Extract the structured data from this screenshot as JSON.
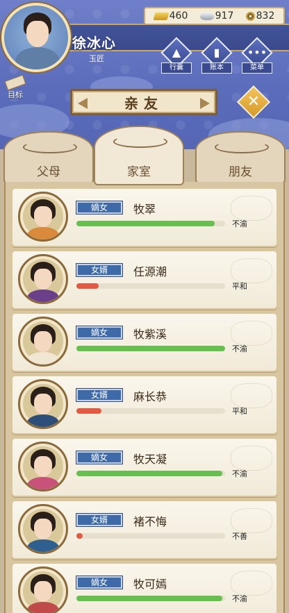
{
  "player": {
    "name": "徐冰心",
    "title": "玉匠"
  },
  "currency": {
    "gold": "460",
    "silver": "917",
    "copper": "832"
  },
  "menu": {
    "bag_label": "行囊",
    "ledger_label": "账本",
    "menu_label": "菜单",
    "goal_label": "目标"
  },
  "panel": {
    "title": "亲友",
    "close_glyph": "✕"
  },
  "tabs": [
    {
      "label": "父母",
      "active": false
    },
    {
      "label": "家室",
      "active": true
    },
    {
      "label": "朋友",
      "active": false
    }
  ],
  "colors": {
    "bar_green": "#66bf4f",
    "bar_red": "#e15a44",
    "role_blue": "#3e6aa8"
  },
  "relatives": [
    {
      "role": "嫡女",
      "name": "牧翠",
      "mood": "不渝",
      "bar_percent": 93,
      "bar_color": "green",
      "robe": "#d98a3b"
    },
    {
      "role": "女婿",
      "name": "任源潮",
      "mood": "平和",
      "bar_percent": 15,
      "bar_color": "red",
      "robe": "#6b3f8a"
    },
    {
      "role": "嫡女",
      "name": "牧紫溪",
      "mood": "不渝",
      "bar_percent": 100,
      "bar_color": "green",
      "robe": "#f0e6d2"
    },
    {
      "role": "女婿",
      "name": "麻长恭",
      "mood": "平和",
      "bar_percent": 17,
      "bar_color": "red",
      "robe": "#2e4e7a"
    },
    {
      "role": "嫡女",
      "name": "牧天凝",
      "mood": "不渝",
      "bar_percent": 98,
      "bar_color": "green",
      "robe": "#c9527a"
    },
    {
      "role": "女婿",
      "name": "褚不悔",
      "mood": "不善",
      "bar_percent": 4,
      "bar_color": "red",
      "robe": "#2f5f8f"
    },
    {
      "role": "嫡女",
      "name": "牧可嫣",
      "mood": "不渝",
      "bar_percent": 98,
      "bar_color": "green",
      "robe": "#c04a4a"
    }
  ]
}
